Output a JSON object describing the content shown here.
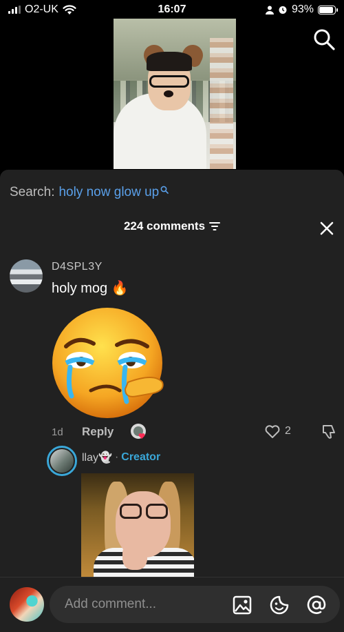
{
  "status": {
    "carrier": "O2-UK",
    "time": "16:07",
    "battery": "93%",
    "battery_level": 0.93
  },
  "search": {
    "label": "Search:",
    "term": "holy now glow up"
  },
  "comments_header": {
    "count_label": "224 comments"
  },
  "comment": {
    "username": "D4SPL3Y",
    "text": "holy mog 🔥",
    "time": "1d",
    "reply_label": "Reply",
    "likes": "2"
  },
  "reply": {
    "username": "llay👻",
    "separator": "·",
    "badge": "Creator"
  },
  "composer": {
    "placeholder": "Add comment..."
  },
  "colors": {
    "accent": "#5aa0ea",
    "creator": "#3aa7d8",
    "sheet_bg": "#212121"
  },
  "icons": [
    "search-icon",
    "filter-icon",
    "close-icon",
    "heart-icon",
    "dislike-icon",
    "image-icon",
    "emoji-icon",
    "mention-icon",
    "wifi-icon",
    "alarm-icon"
  ]
}
